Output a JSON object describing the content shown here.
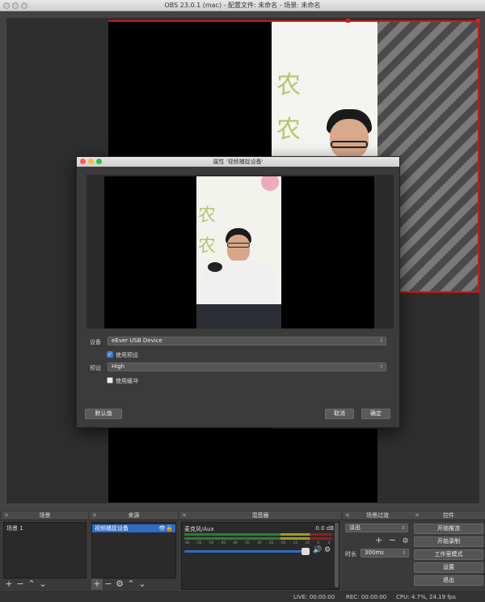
{
  "window": {
    "title": "OBS 23.0.1 (mac) - 配置文件: 未命名 - 场景: 未命名"
  },
  "preview": {
    "image_text": [
      "农",
      "农"
    ]
  },
  "dialog": {
    "title": "属性 '视频捕捉设备'",
    "device_label": "设备",
    "device_value": "eEver USB Device",
    "use_preset_label": "使用预设",
    "use_preset_checked": true,
    "preset_label": "预设",
    "preset_value": "High",
    "use_buffer_label": "使用缓冲",
    "use_buffer_checked": false,
    "defaults_button": "默认值",
    "cancel_button": "取消",
    "ok_button": "确定",
    "image_text": [
      "农",
      "农"
    ]
  },
  "docks": {
    "scenes": {
      "title": "场景",
      "items": [
        "场景 1"
      ]
    },
    "sources": {
      "title": "来源",
      "items": [
        "视频捕捉设备"
      ]
    },
    "mixer": {
      "title": "混音器",
      "channel_name": "麦克风/Aux",
      "channel_db": "0.0 dB",
      "ticks": [
        "-60",
        "-55",
        "-50",
        "-45",
        "-40",
        "-35",
        "-30",
        "-25",
        "-20",
        "-15",
        "-10",
        "-5",
        "0"
      ]
    },
    "transitions": {
      "title": "场景过渡",
      "transition_value": "淡出",
      "duration_label": "时长",
      "duration_value": "300ms"
    },
    "controls": {
      "title": "控件",
      "buttons": [
        "开始推流",
        "开始录制",
        "工作室模式",
        "设置",
        "退出"
      ]
    }
  },
  "status": {
    "live": "LIVE: 00:00:00",
    "rec": "REC: 00:00:00",
    "cpu": "CPU: 4.7%, 24.19 fps"
  },
  "colors": {
    "accent": "#2e6bc6",
    "selection": "#c81818"
  }
}
